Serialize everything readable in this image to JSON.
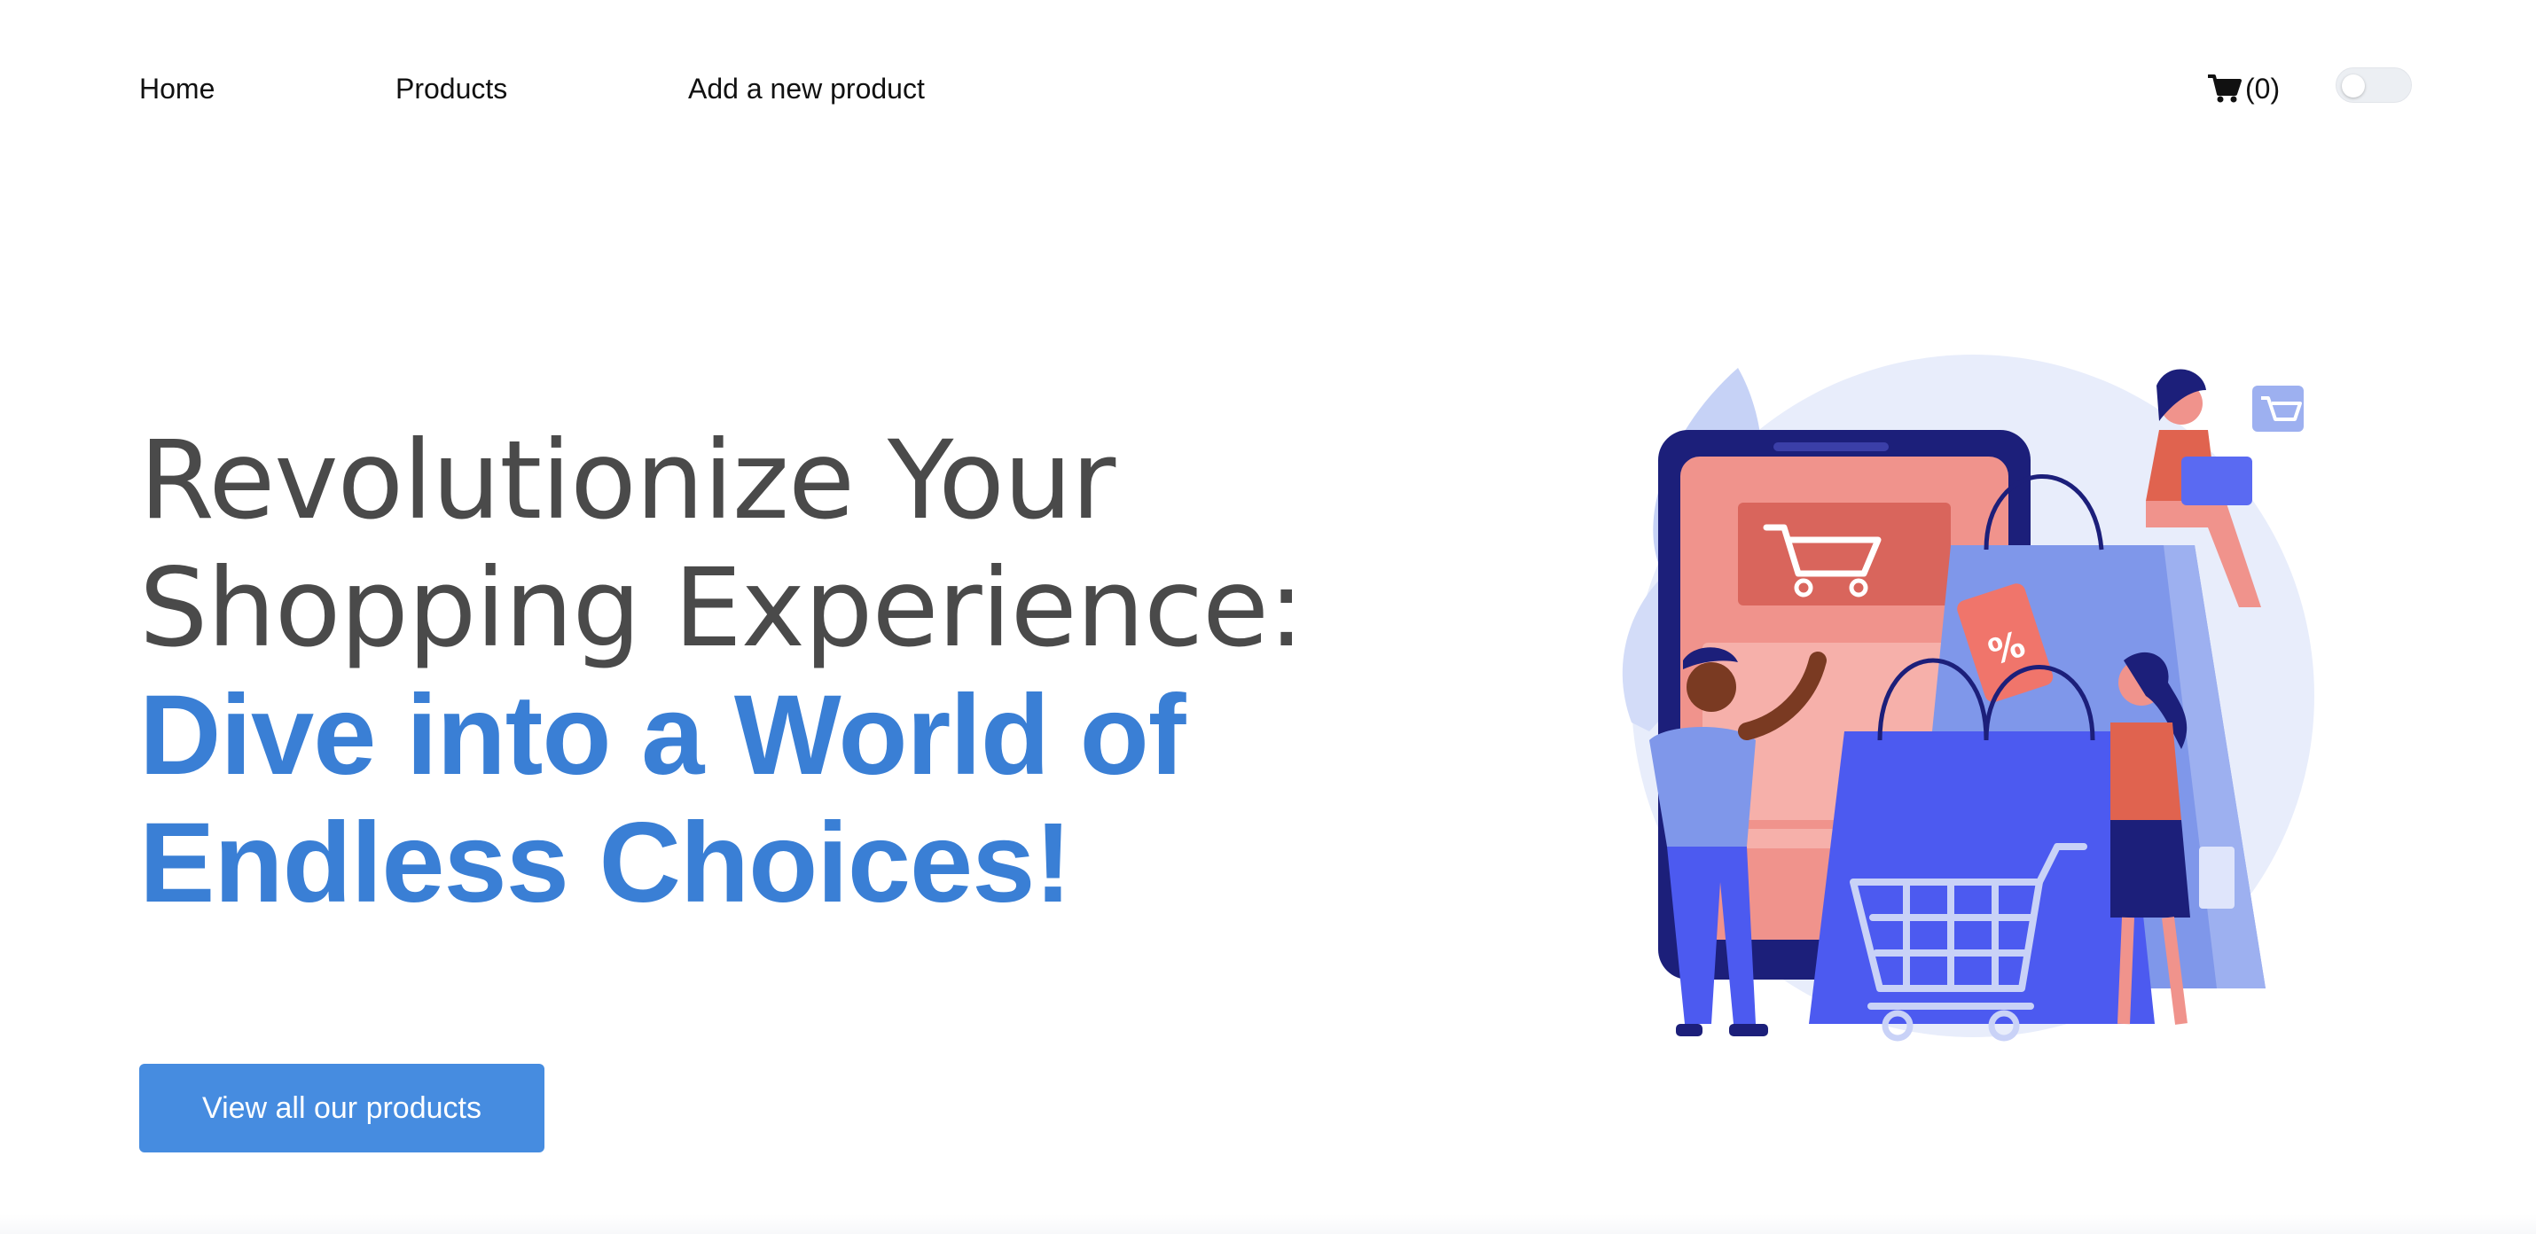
{
  "nav": {
    "home_label": "Home",
    "products_label": "Products",
    "add_product_label": "Add a new product",
    "cart_icon": "cart-icon",
    "cart_count": "(0)",
    "theme_toggle": {
      "state": "off"
    }
  },
  "hero": {
    "line1": "Revolutionize Your",
    "line2": "Shopping Experience:",
    "line3": "Dive into a World of",
    "line4": "Endless Choices!",
    "cta_label": "View all our products"
  },
  "illustration": {
    "icon": "shopping-illustration",
    "discount_tag": "%"
  },
  "colors": {
    "accent": "#3a7fd5",
    "button": "#468ce0",
    "heading_gray": "#4a4a4a"
  }
}
